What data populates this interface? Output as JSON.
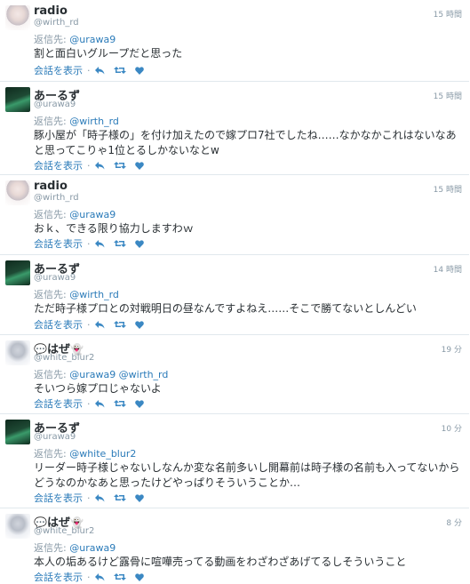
{
  "ui": {
    "reply_prefix": "返信先:",
    "show_conversation": "会話を表示",
    "separator": "·",
    "icons": [
      "reply-icon",
      "retweet-icon",
      "like-icon"
    ]
  },
  "tweets": [
    {
      "name": "radio",
      "handle": "@wirth_rd",
      "time": "15 時間",
      "reply_to": "@urawa9",
      "text": "割と面白いグループだと思った",
      "avatar": "radio"
    },
    {
      "name": "あーるず",
      "handle": "@urawa9",
      "time": "15 時間",
      "reply_to": "@wirth_rd",
      "text": "豚小屋が「時子様の」を付け加えたので嫁プロ7社でしたね……なかなかこれはないなあと思ってこりゃ1位とるしかないなとw",
      "avatar": "aru"
    },
    {
      "name": "radio",
      "handle": "@wirth_rd",
      "time": "15 時間",
      "reply_to": "@urawa9",
      "text": "おｋ、できる限り協力しますわｗ",
      "avatar": "radio"
    },
    {
      "name": "あーるず",
      "handle": "@urawa9",
      "time": "14 時間",
      "reply_to": "@wirth_rd",
      "text": "ただ時子様プロとの対戦明日の昼なんですよねえ……そこで勝てないとしんどい",
      "avatar": "aru"
    },
    {
      "name_pre": "💬",
      "name": "はぜ",
      "name_post": "👻",
      "handle": "@white_blur2",
      "time": "19 分",
      "reply_to": "@urawa9 @wirth_rd",
      "text": "そいつら嫁プロじゃないよ",
      "avatar": "haze"
    },
    {
      "name": "あーるず",
      "handle": "@urawa9",
      "time": "10 分",
      "reply_to": "@white_blur2",
      "text": "リーダー時子様じゃないしなんか変な名前多いし開幕前は時子様の名前も入ってないからどうなのかなあと思ったけどやっぱりそういうことか…",
      "avatar": "aru"
    },
    {
      "name_pre": "💬",
      "name": "はぜ",
      "name_post": "👻",
      "handle": "@white_blur2",
      "time": "8 分",
      "reply_to": "@urawa9",
      "text": "本人の垢あるけど露骨に喧嘩売ってる動画をわざわざあげてるしそういうこと",
      "avatar": "haze"
    }
  ]
}
